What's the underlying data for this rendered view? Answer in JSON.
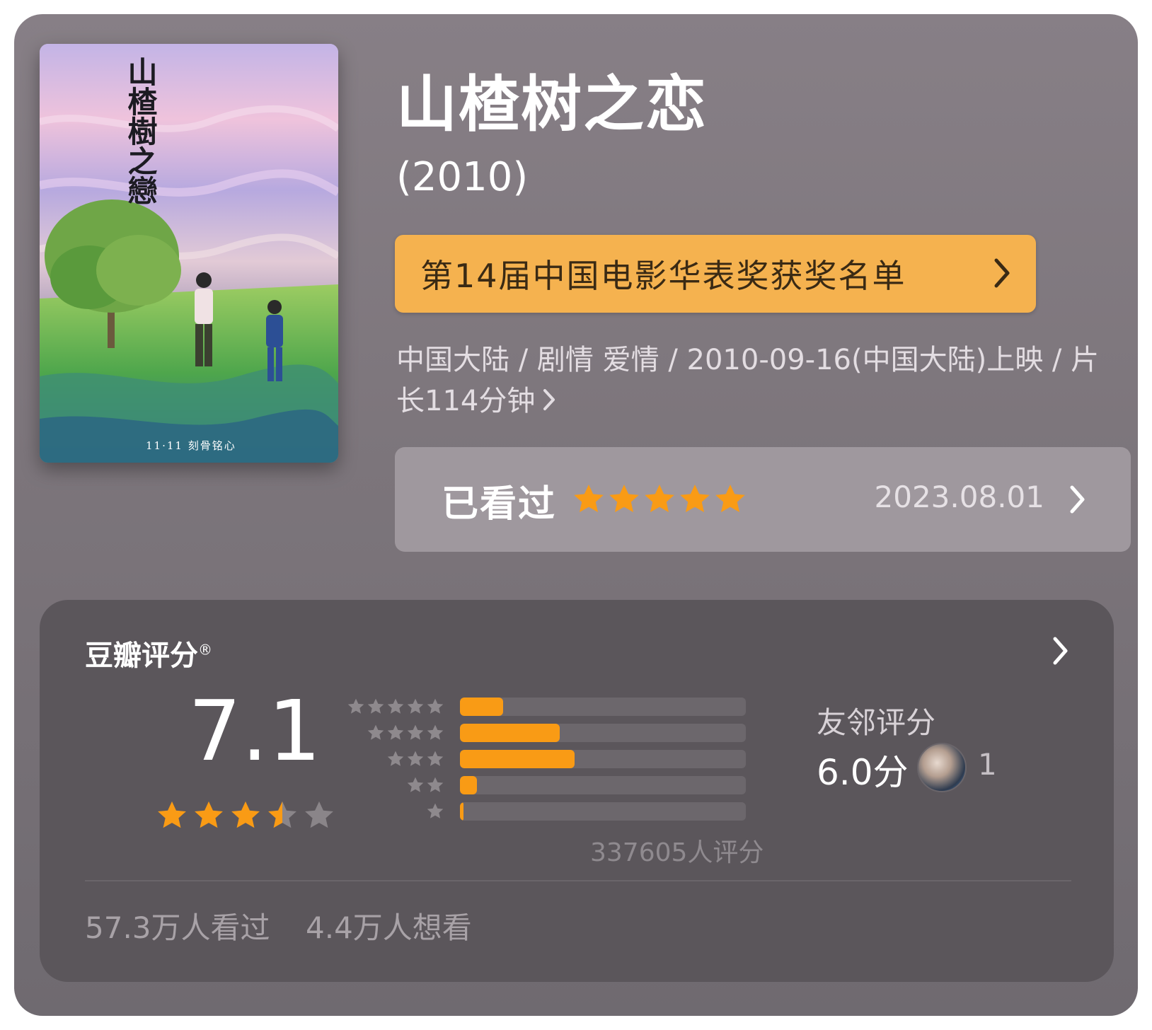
{
  "movie": {
    "title": "山楂树之恋",
    "year": "(2010)",
    "poster": {
      "title_vertical": "山楂樹之戀",
      "tagline": "11·11 刻骨铭心"
    }
  },
  "award_banner": {
    "label": "第14届中国电影华表奖获奖名单",
    "icon": "chevron-right-icon"
  },
  "meta": {
    "line": "中国大陆 / 剧情 爱情 / 2010-09-16(中国大陆)上映 / 片长114分钟",
    "icon": "chevron-right-icon"
  },
  "watched": {
    "label": "已看过",
    "my_rating_stars": 5,
    "date": "2023.08.01"
  },
  "rating": {
    "heading": "豆瓣评分",
    "registered_mark": "®",
    "score": "7.1",
    "star_rating": 3.5,
    "distribution": [
      {
        "stars": 5,
        "fraction": 0.15
      },
      {
        "stars": 4,
        "fraction": 0.35
      },
      {
        "stars": 3,
        "fraction": 0.4
      },
      {
        "stars": 2,
        "fraction": 0.06
      },
      {
        "stars": 1,
        "fraction": 0.01
      }
    ],
    "count_text": "337605人评分",
    "friends": {
      "label": "友邻评分",
      "score": "6.0分",
      "count": "1"
    },
    "stats": {
      "watched": "57.3万人看过",
      "want": "4.4万人想看"
    }
  },
  "colors": {
    "accent_orange": "#f99b15",
    "banner_orange": "#f5b24f",
    "panel_bg": "#5b565b",
    "card_bg": "#817a80"
  }
}
